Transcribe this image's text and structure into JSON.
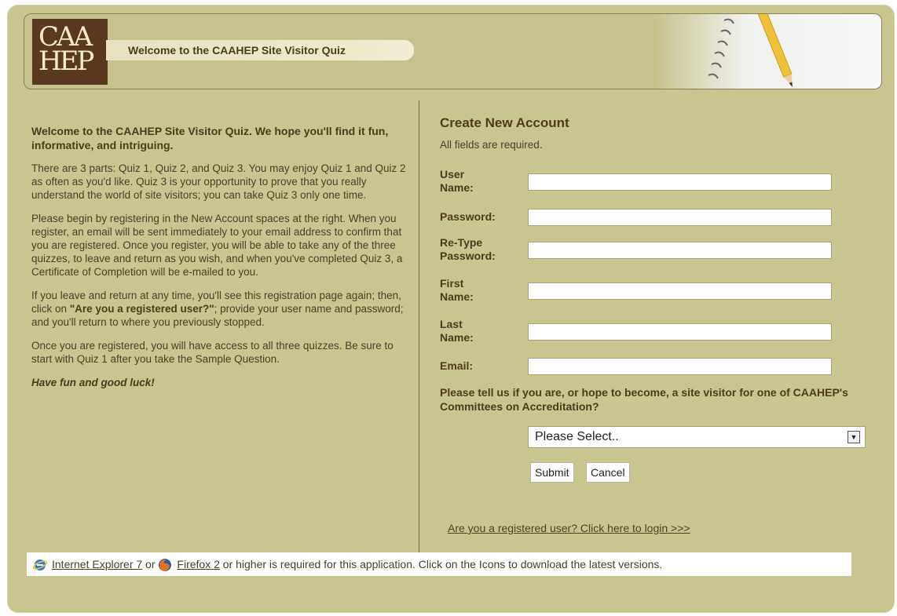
{
  "header": {
    "logo_line1": "CAA",
    "logo_line2": "HEP",
    "welcome_title": "Welcome to the CAAHEP Site Visitor Quiz"
  },
  "intro": {
    "lead": "Welcome to the CAAHEP Site Visitor Quiz. We hope you'll find it fun, informative, and intriguing.",
    "p1": "There are 3 parts: Quiz 1, Quiz 2, and Quiz 3. You may enjoy Quiz 1 and Quiz 2 as often as you'd like. Quiz 3 is your opportunity to prove that you really understand the world of site visitors; you can take Quiz 3 only one time.",
    "p2": "Please begin by registering in the New Account spaces at the right. When you register, an email will be sent immediately to your email address to confirm that you are registered. Once you register, you will be able to take any of the three quizzes, to leave and return as you wish, and when you've completed Quiz 3, a Certificate of Completion will be e-mailed to you.",
    "p3_start": "If you leave and return at any time, you'll see this registration page again; then, click on ",
    "p3_bold": "\"Are you a registered user?\"",
    "p3_end": "; provide your user name and password; and you'll return to where you previously stopped.",
    "p4": "Once you are registered, you will have access to all three quizzes. Be sure to start with Quiz 1 after you take the Sample Question.",
    "closing": "Have fun and good luck!"
  },
  "form": {
    "title": "Create New Account",
    "required_note": "All fields are required.",
    "labels": {
      "username": "User Name:",
      "password": "Password:",
      "retype": "Re-Type Password:",
      "first": "First Name:",
      "last": "Last Name:",
      "email": "Email:"
    },
    "question": "Please tell us if you are, or hope to become, a site visitor for one of CAAHEP's Committees on Accreditation?",
    "select_value": "Please Select..",
    "submit_label": "Submit",
    "cancel_label": "Cancel",
    "login_link": "Are you a registered user? Click here to login >>>"
  },
  "footer": {
    "ie_link": "Internet Explorer 7",
    "or_text": " or ",
    "ff_link": "Firefox 2",
    "rest": " or higher is required for this application. Click on the Icons to download the latest versions."
  },
  "colors": {
    "background": "#c8c58f",
    "logo": "#5a3a1e",
    "text": "#4e3b1b"
  }
}
